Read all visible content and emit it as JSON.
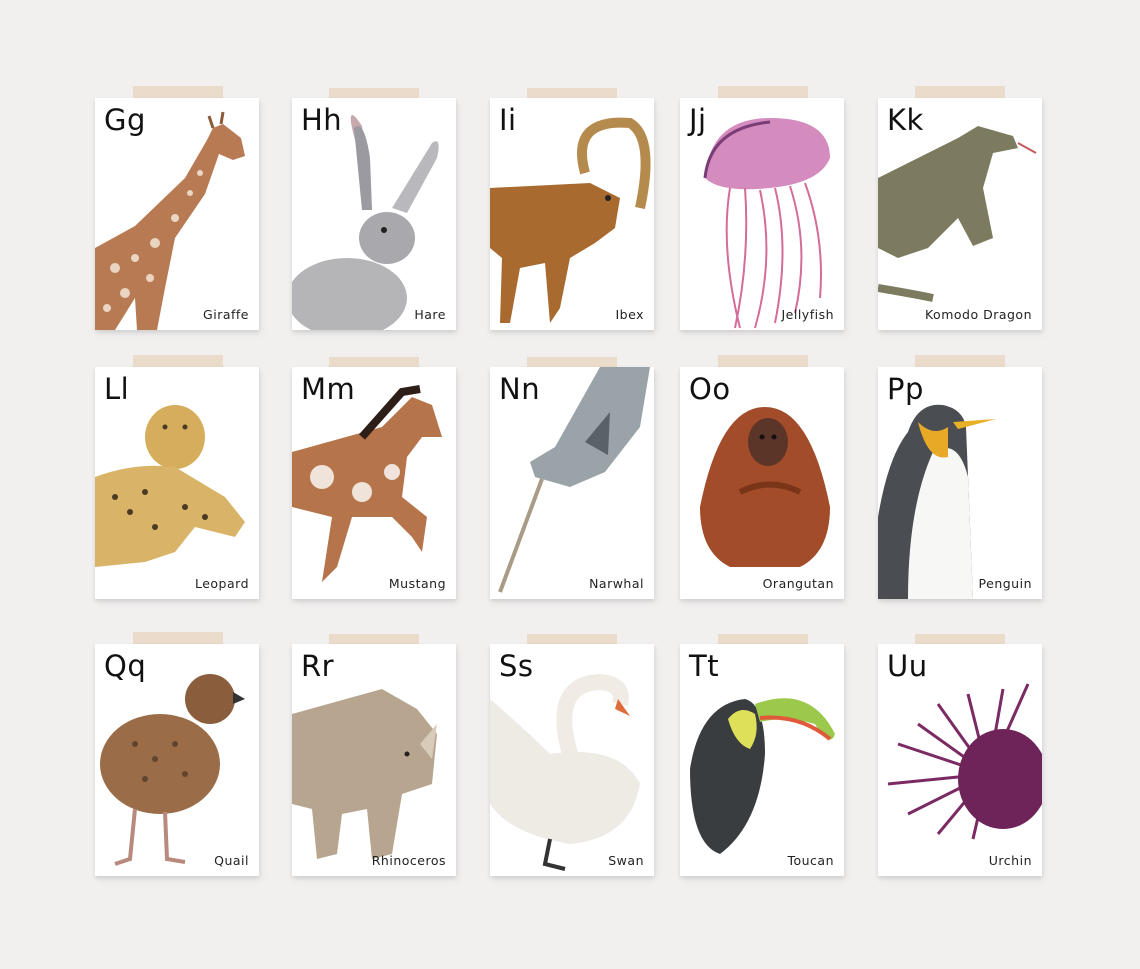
{
  "cards": [
    {
      "letter": "Gg",
      "name": "Giraffe",
      "icon": "giraffe-illustration"
    },
    {
      "letter": "Hh",
      "name": "Hare",
      "icon": "hare-illustration"
    },
    {
      "letter": "Ii",
      "name": "Ibex",
      "icon": "ibex-illustration"
    },
    {
      "letter": "Jj",
      "name": "Jellyfish",
      "icon": "jellyfish-illustration"
    },
    {
      "letter": "Kk",
      "name": "Komodo Dragon",
      "icon": "komodo-dragon-illustration"
    },
    {
      "letter": "Ll",
      "name": "Leopard",
      "icon": "leopard-illustration"
    },
    {
      "letter": "Mm",
      "name": "Mustang",
      "icon": "mustang-illustration"
    },
    {
      "letter": "Nn",
      "name": "Narwhal",
      "icon": "narwhal-illustration"
    },
    {
      "letter": "Oo",
      "name": "Orangutan",
      "icon": "orangutan-illustration"
    },
    {
      "letter": "Pp",
      "name": "Penguin",
      "icon": "penguin-illustration"
    },
    {
      "letter": "Qq",
      "name": "Quail",
      "icon": "quail-illustration"
    },
    {
      "letter": "Rr",
      "name": "Rhinoceros",
      "icon": "rhinoceros-illustration"
    },
    {
      "letter": "Ss",
      "name": "Swan",
      "icon": "swan-illustration"
    },
    {
      "letter": "Tt",
      "name": "Toucan",
      "icon": "toucan-illustration"
    },
    {
      "letter": "Uu",
      "name": "Urchin",
      "icon": "urchin-illustration"
    }
  ],
  "colors": {
    "wall": "#f1f0ef",
    "card": "#ffffff",
    "tape": "#ead9c8"
  }
}
